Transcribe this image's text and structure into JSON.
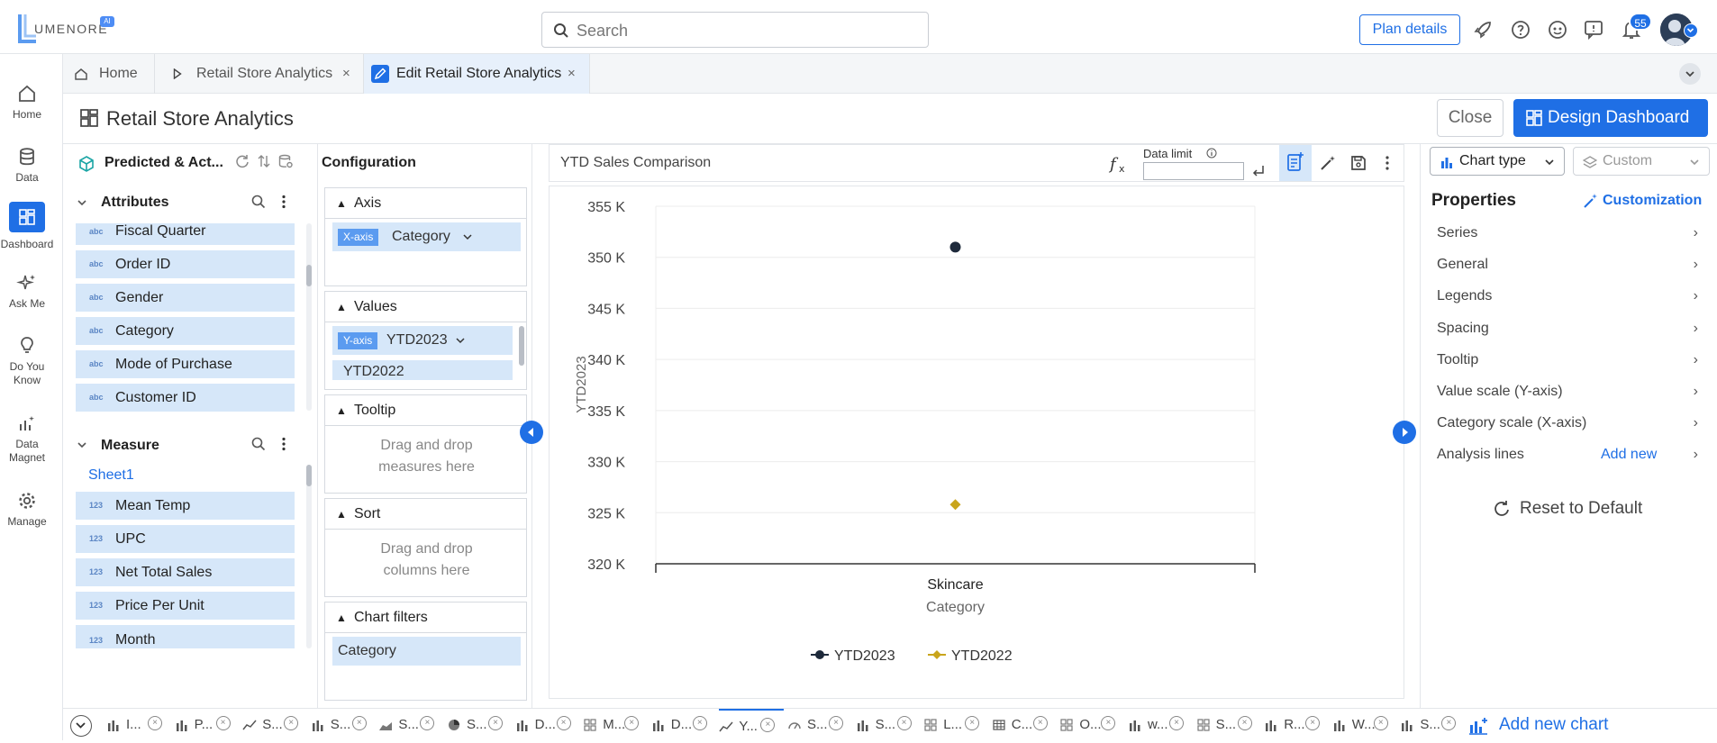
{
  "app": {
    "logo_text": "UMENORE",
    "logo_badge": "AI"
  },
  "search": {
    "placeholder": "Search"
  },
  "header": {
    "plan_label": "Plan details",
    "notification_count": "55"
  },
  "nav": {
    "items": [
      {
        "label": "Home",
        "icon": "home-icon"
      },
      {
        "label": "Data",
        "icon": "database-icon"
      },
      {
        "label": "Dashboard",
        "icon": "dashboard-icon"
      },
      {
        "label": "Ask Me",
        "icon": "sparkle-icon"
      },
      {
        "label": "Do You Know",
        "icon": "lightbulb-icon"
      },
      {
        "label": "Data Magnet",
        "icon": "data-magnet-icon"
      },
      {
        "label": "Manage",
        "icon": "gear-icon"
      }
    ]
  },
  "tabs": [
    {
      "label": "Home"
    },
    {
      "label": "Retail Store Analytics"
    },
    {
      "label": "Edit Retail Store Analytics"
    }
  ],
  "title": {
    "text": "Retail Store Analytics",
    "close_label": "Close",
    "design_label": "Design Dashboard"
  },
  "datasource": {
    "name": "Predicted & Act..."
  },
  "attributes": {
    "title": "Attributes",
    "tag": "abc",
    "items": [
      "Fiscal Quarter",
      "Order ID",
      "Gender",
      "Category",
      "Mode of Purchase",
      "Customer ID"
    ]
  },
  "measures": {
    "title": "Measure",
    "sheet": "Sheet1",
    "tag": "123",
    "items": [
      "Mean Temp",
      "UPC",
      "Net Total Sales",
      "Price Per Unit",
      "Month"
    ]
  },
  "config": {
    "title": "Configuration",
    "axis": {
      "title": "Axis",
      "badge": "X-axis",
      "value": "Category"
    },
    "values": {
      "title": "Values",
      "badge": "Y-axis",
      "value1": "YTD2023",
      "value2": "YTD2022"
    },
    "tooltip": {
      "title": "Tooltip",
      "hint_line1": "Drag and drop",
      "hint_line2": "measures here"
    },
    "sort": {
      "title": "Sort",
      "hint_line1": "Drag and drop",
      "hint_line2": "columns here"
    },
    "filters": {
      "title": "Chart filters",
      "value": "Category"
    }
  },
  "chart_header": {
    "title": "YTD Sales Comparison",
    "data_limit_label": "Data limit",
    "data_limit_value": ""
  },
  "chart_data": {
    "type": "scatter",
    "categories": [
      "Skincare"
    ],
    "series": [
      {
        "name": "YTD2023",
        "values": [
          351000
        ],
        "color": "#1e2a3b",
        "marker": "circle"
      },
      {
        "name": "YTD2022",
        "values": [
          325800
        ],
        "color": "#c9a51c",
        "marker": "diamond"
      }
    ],
    "ylabel": "YTD2023",
    "xlabel": "Category",
    "ylim": [
      320000,
      355000
    ],
    "yticks": [
      "320 K",
      "325 K",
      "330 K",
      "335 K",
      "340 K",
      "345 K",
      "350 K",
      "355 K"
    ],
    "grid": true,
    "legend": "bottom"
  },
  "properties": {
    "chart_type_label": "Chart type",
    "custom_label": "Custom",
    "title": "Properties",
    "customization_label": "Customization",
    "items": [
      "Series",
      "General",
      "Legends",
      "Spacing",
      "Tooltip",
      "Value scale (Y-axis)",
      "Category scale (X-axis)",
      "Analysis lines"
    ],
    "add_new_label": "Add new",
    "reset_label": "Reset to Default"
  },
  "bottom_tabs": [
    {
      "label": "I...",
      "icon": "bar-chart-icon"
    },
    {
      "label": "P...",
      "icon": "bar-chart-icon"
    },
    {
      "label": "S...",
      "icon": "line-chart-icon"
    },
    {
      "label": "S...",
      "icon": "bar-chart-icon"
    },
    {
      "label": "S...",
      "icon": "area-chart-icon"
    },
    {
      "label": "S...",
      "icon": "pie-chart-icon"
    },
    {
      "label": "D...",
      "icon": "bar-chart-icon"
    },
    {
      "label": "M...",
      "icon": "grid-icon"
    },
    {
      "label": "D...",
      "icon": "bar-chart-icon"
    },
    {
      "label": "Y...",
      "icon": "line-chart-icon"
    },
    {
      "label": "S...",
      "icon": "gauge-icon"
    },
    {
      "label": "S...",
      "icon": "bar-chart-icon"
    },
    {
      "label": "L...",
      "icon": "grid-icon"
    },
    {
      "label": "C...",
      "icon": "table-icon"
    },
    {
      "label": "O...",
      "icon": "grid-icon"
    },
    {
      "label": "w...",
      "icon": "bar-chart-icon"
    },
    {
      "label": "S...",
      "icon": "grid-icon"
    },
    {
      "label": "R...",
      "icon": "bar-chart-icon"
    },
    {
      "label": "W...",
      "icon": "bar-chart-icon"
    },
    {
      "label": "S...",
      "icon": "bar-chart-icon"
    }
  ],
  "add_chart_label": "Add new chart",
  "colors": {
    "accent": "#1f6fe5",
    "field_bg": "#d6e7f9",
    "series1": "#1e2a3b",
    "series2": "#c9a51c"
  }
}
